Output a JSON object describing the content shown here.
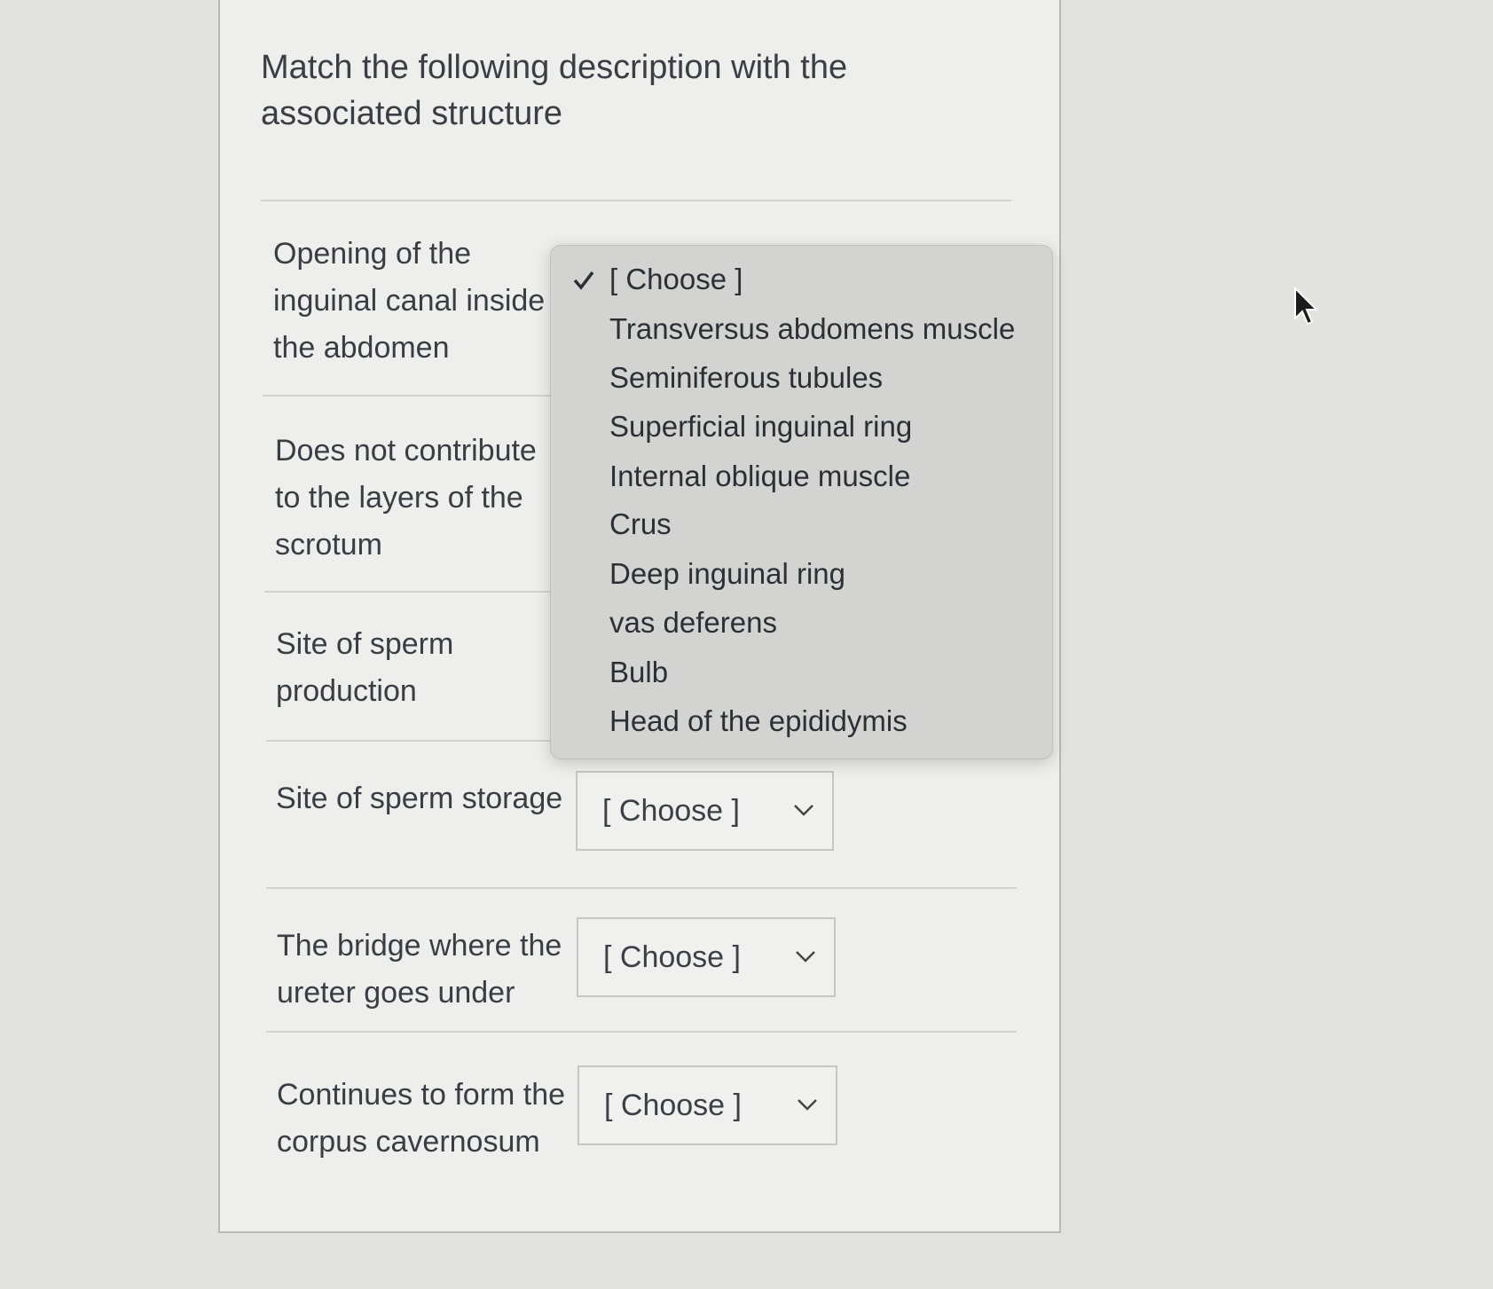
{
  "question": {
    "line1": "Match the following description with the",
    "line2": "associated structure"
  },
  "rows": [
    {
      "lines": [
        "Opening of the",
        "inguinal canal inside",
        "the abdomen"
      ]
    },
    {
      "lines": [
        "Does not contribute",
        "to the layers of the",
        "scrotum"
      ]
    },
    {
      "lines": [
        "Site of sperm",
        "production"
      ]
    },
    {
      "lines": [
        "Site of sperm storage"
      ],
      "select": "[ Choose ]"
    },
    {
      "lines": [
        "The bridge where the",
        "ureter goes under"
      ],
      "select": "[ Choose ]"
    },
    {
      "lines": [
        "Continues to form the",
        "corpus cavernosum"
      ],
      "select": "[ Choose ]"
    }
  ],
  "dropdown": {
    "selected": "[ Choose ]",
    "options": [
      "[ Choose ]",
      "Transversus abdomens muscle",
      "Seminiferous tubules",
      "Superficial inguinal ring",
      "Internal oblique muscle",
      "Crus",
      "Deep inguinal ring",
      "vas deferens",
      "Bulb",
      "Head of the epididymis"
    ]
  },
  "icons": {
    "checkmark": "checkmark-icon",
    "chevron": "chevron-down-icon",
    "cursor": "mouse-pointer-icon"
  },
  "colors": {
    "background": "#e2e2df",
    "card": "#eeeeec",
    "dropdown": "#d3d4d2",
    "text": "#3a3d44"
  }
}
